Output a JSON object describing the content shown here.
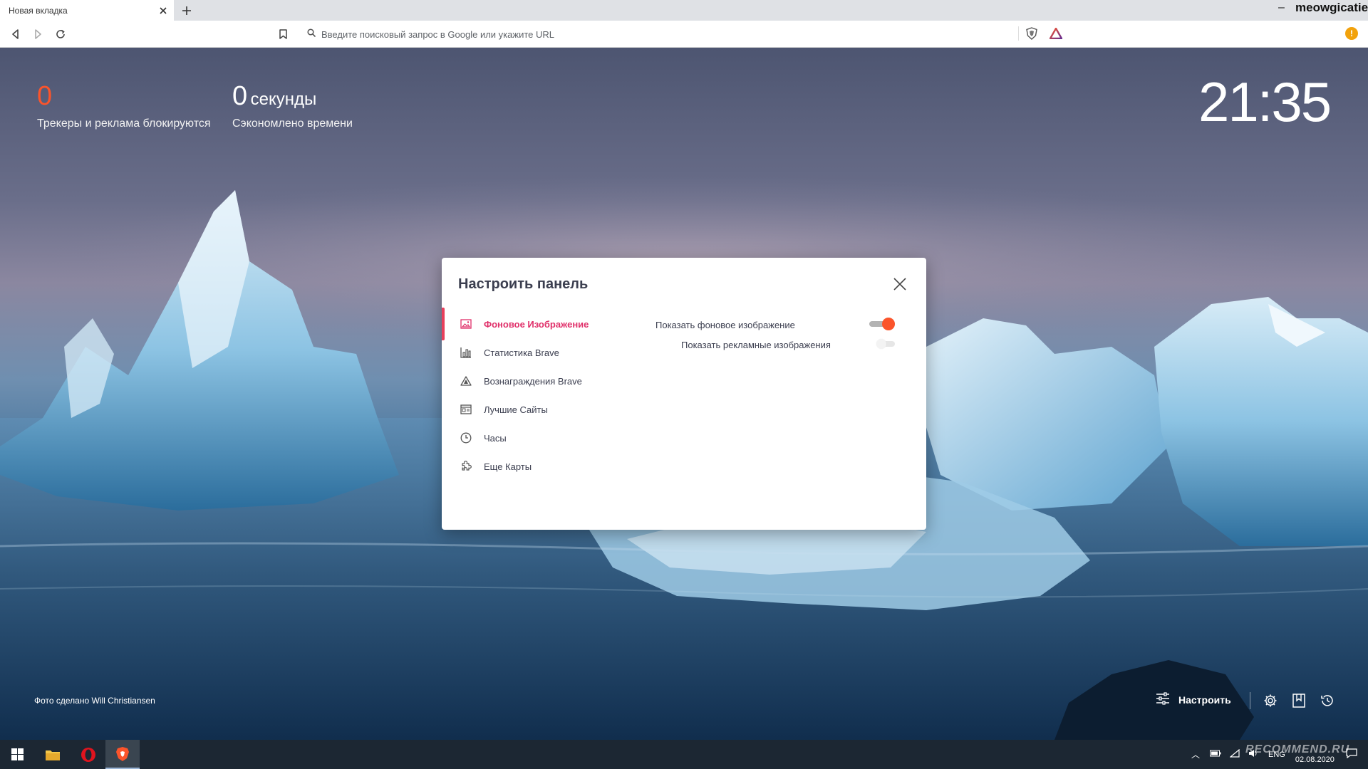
{
  "browser": {
    "tab_title": "Новая вкладка",
    "profile_name": "meowgicatie",
    "omnibox_placeholder": "Введите поисковый запрос в Google или укажите URL"
  },
  "stats": {
    "trackers_value": "0",
    "trackers_label": "Трекеры и реклама блокируются",
    "time_value": "0",
    "time_unit": "секунды",
    "time_label": "Сэкономлено времени"
  },
  "clock": {
    "time": "21:35"
  },
  "dialog": {
    "title": "Настроить панель",
    "menu": [
      {
        "label": "Фоновое Изображение",
        "icon": "image-icon",
        "active": true
      },
      {
        "label": "Статистика Brave",
        "icon": "bar-chart-icon",
        "active": false
      },
      {
        "label": "Вознаграждения Brave",
        "icon": "rewards-triangle-icon",
        "active": false
      },
      {
        "label": "Лучшие Сайты",
        "icon": "top-sites-icon",
        "active": false
      },
      {
        "label": "Часы",
        "icon": "clock-icon",
        "active": false
      },
      {
        "label": "Еще Карты",
        "icon": "puzzle-icon",
        "active": false
      }
    ],
    "options": [
      {
        "label": "Показать фоновое изображение",
        "enabled": true
      },
      {
        "label": "Показать рекламные изображения",
        "enabled": false
      }
    ]
  },
  "footer": {
    "credit_prefix": "Фото сделано",
    "credit_author": "Will Christiansen",
    "customize_label": "Настроить"
  },
  "taskbar": {
    "language": "ENG",
    "date": "02.08.2020",
    "watermark": "RECOMMEND.RU"
  },
  "colors": {
    "accent": "#fb542b",
    "active_menu": "#e0306a",
    "tracker_number": "#fb542b"
  }
}
